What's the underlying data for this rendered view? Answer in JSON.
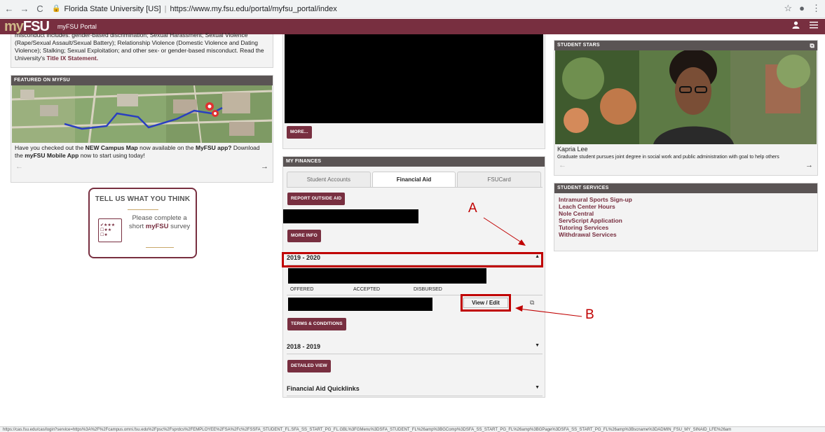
{
  "browser": {
    "site_name": "Florida State University [US]",
    "url": "https://www.my.fsu.edu/portal/myfsu_portal/index",
    "status_url": "https://cas.fsu.edu/cas/login?service=https%3A%2F%2Fcampus.omni.fsu.edu%2Fpsc%2Fsprdcs%2FEMPLOYEE%2FSA%2Fc%2FSSFA_STUDENT_FL.SFA_SS_START_PG_FL.GBL%3FGMenu%3DSFA_STUDENT_FL%26amp%3BGComp%3DSFA_SS_START_PG_FL%26amp%3BGPage%3DSFA_SS_START_PG_FL%26amp%3Bscname%3DADMIN_FSU_MY_SINAID_LFE%26am"
  },
  "appbar": {
    "logo_my": "my",
    "logo_fsu": "FSU",
    "portal_title": "myFSU Portal"
  },
  "title_ix": {
    "text_line0": "misconduct includes: gender-based discrimination; Sexual Harassment; Sexual Violence",
    "text_line1": "(Rape/Sexual Assault/Sexual Battery); Relationship Violence (Domestic Violence and Dating",
    "text_line2": "Violence); Stalking; Sexual Exploitation; and other sex- or gender-based misconduct. Read the",
    "text_line3_prefix": "University's ",
    "link": "Title IX Statement."
  },
  "featured": {
    "header": "FEATURED ON MYFSU",
    "text_a": "Have you checked out the ",
    "text_b": "NEW Campus Map",
    "text_c": " now available on the ",
    "text_d": "MyFSU app?",
    "text_e": " Download",
    "text_f": "the ",
    "text_g": "myFSU Mobile App",
    "text_h": " now to start using today!",
    "prev": "←",
    "next": "→"
  },
  "survey": {
    "title": "TELL US WHAT YOU THINK",
    "line1": "Please complete a",
    "line2_prefix": "short ",
    "line2_bold": "myFSU",
    "line2_suffix": " survey"
  },
  "media": {
    "more_button": "MORE..."
  },
  "finances": {
    "header": "MY FINANCES",
    "tabs": [
      "Student Accounts",
      "Financial Aid",
      "FSUCard"
    ],
    "report_button": "REPORT OUTSIDE AID",
    "more_info_button": "MORE INFO",
    "year_current": "2019 - 2020",
    "caret_up": "▲",
    "caret_down": "▼",
    "columns": [
      "OFFERED",
      "ACCEPTED",
      "DISBURSED"
    ],
    "view_edit": "View / Edit",
    "terms_button": "TERMS & CONDITIONS",
    "year_previous": "2018 - 2019",
    "detailed_button": "DETAILED VIEW",
    "quicklinks": "Financial Aid Quicklinks"
  },
  "stars": {
    "header": "STUDENT STARS",
    "name": "Kapria Lee",
    "caption": "Graduate student pursues joint degree in social work and public administration with goal to help others",
    "prev": "←",
    "next": "→"
  },
  "services": {
    "header": "STUDENT SERVICES",
    "items": [
      "Intramural Sports Sign-up",
      "Leach Center Hours",
      "Nole Central",
      "ServScript Application",
      "Tutoring Services",
      "Withdrawal Services"
    ]
  },
  "annotations": {
    "a": "A",
    "b": "B"
  },
  "colors": {
    "garnet": "#782f40",
    "gold": "#ceb888",
    "annotation_red": "#c00000"
  }
}
